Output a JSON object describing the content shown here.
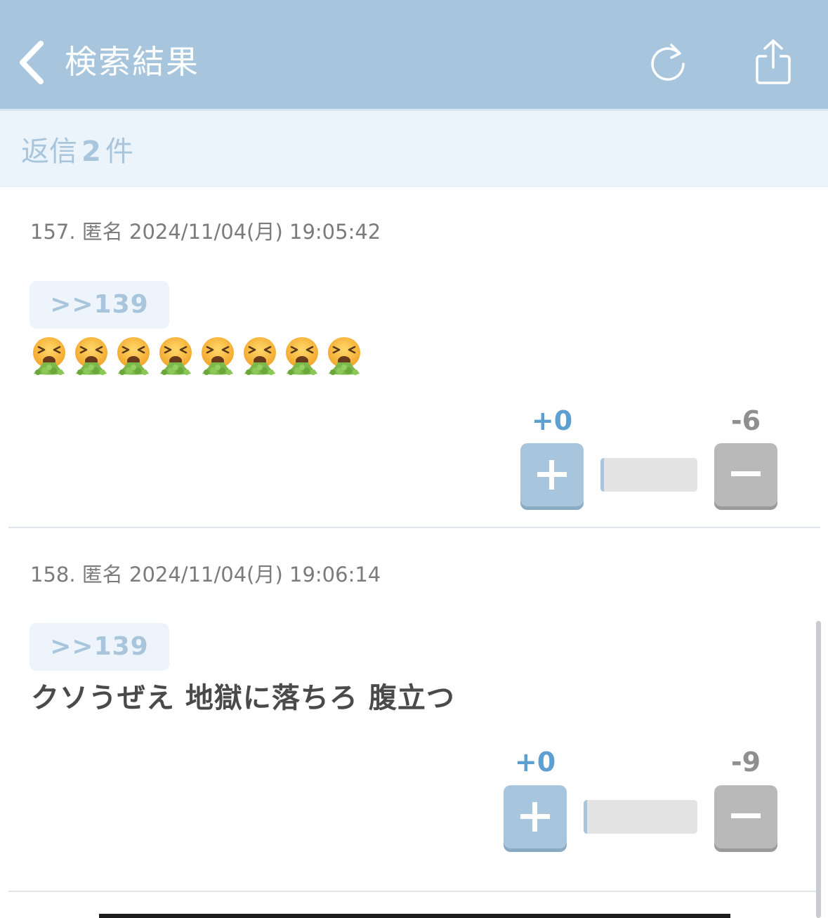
{
  "header": {
    "title": "検索結果",
    "back_icon": "chevron-left-icon",
    "reload_icon": "reload-icon",
    "share_icon": "share-icon",
    "background": "#a7c6de"
  },
  "reply_count": {
    "prefix": "返信",
    "number": "2",
    "suffix": "件"
  },
  "posts": [
    {
      "meta": "157. 匿名 2024/11/04(月) 19:05:42",
      "anchor": ">>139",
      "emoji": "vomiting-face-icon",
      "emoji_count": 8,
      "text": "",
      "plus_score": "+0",
      "minus_score": "-6",
      "plus_ratio": 0
    },
    {
      "meta": "158. 匿名 2024/11/04(月) 19:06:14",
      "anchor": ">>139",
      "text": "クソうぜえ 地獄に落ちろ 腹立つ",
      "plus_score": "+0",
      "minus_score": "-9",
      "plus_ratio": 0
    }
  ],
  "colors": {
    "accent": "#a7c6de",
    "plus": "#5d9fd0",
    "minus": "#8f8f8f"
  }
}
